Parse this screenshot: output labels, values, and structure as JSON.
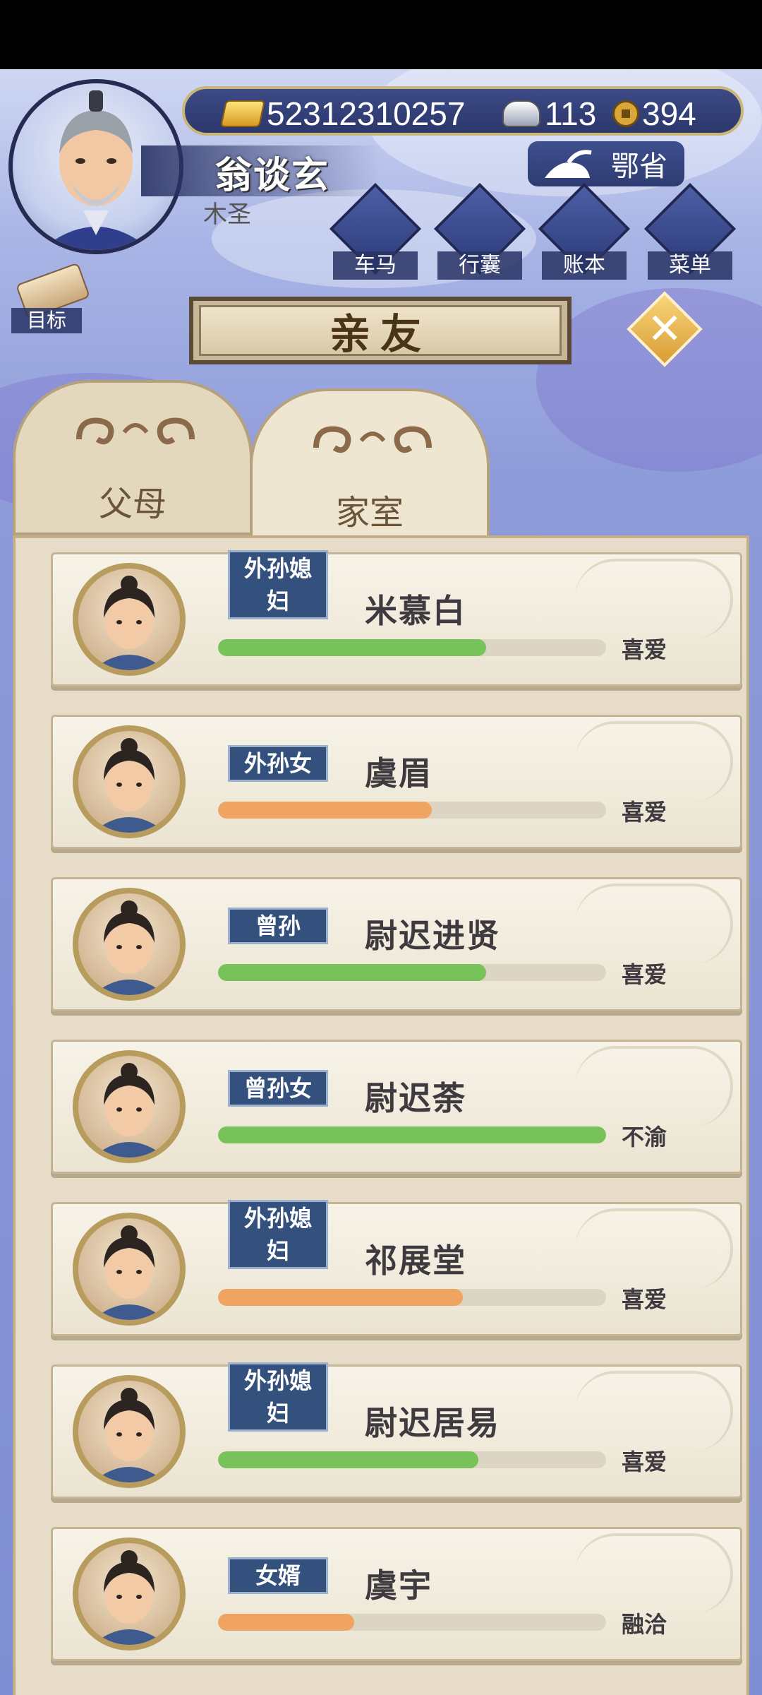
{
  "header": {
    "gold": "52312310257",
    "silver": "113",
    "coins": "394",
    "player_name": "翁谈玄",
    "player_title": "木圣",
    "location": "鄂省"
  },
  "menu": [
    {
      "label": "车马",
      "icon": "carriage-icon"
    },
    {
      "label": "行囊",
      "icon": "bag-icon"
    },
    {
      "label": "账本",
      "icon": "ledger-icon"
    },
    {
      "label": "菜单",
      "icon": "more-icon"
    }
  ],
  "goal_label": "目标",
  "page_title": "亲友",
  "tabs": [
    {
      "label": "父母",
      "active": false
    },
    {
      "label": "家室",
      "active": true
    }
  ],
  "colors": {
    "green": "#78c25a",
    "orange": "#f0a462",
    "relation_bg": "#33517c"
  },
  "relatives": [
    {
      "relation": "外孙媳妇",
      "relation_lines": [
        "外孙媳",
        "妇"
      ],
      "name": "米慕白",
      "affection": 0.69,
      "bar_color": "green",
      "status": "喜爱"
    },
    {
      "relation": "外孙女",
      "relation_lines": [
        "外孙女"
      ],
      "name": "虞眉",
      "affection": 0.55,
      "bar_color": "orange",
      "status": "喜爱"
    },
    {
      "relation": "曾孙",
      "relation_lines": [
        "曾孙"
      ],
      "name": "尉迟进贤",
      "affection": 0.69,
      "bar_color": "green",
      "status": "喜爱"
    },
    {
      "relation": "曾孙女",
      "relation_lines": [
        "曾孙女"
      ],
      "name": "尉迟荼",
      "affection": 1.0,
      "bar_color": "green",
      "status": "不渝"
    },
    {
      "relation": "外孙媳妇",
      "relation_lines": [
        "外孙媳",
        "妇"
      ],
      "name": "祁展堂",
      "affection": 0.63,
      "bar_color": "orange",
      "status": "喜爱"
    },
    {
      "relation": "外孙媳妇",
      "relation_lines": [
        "外孙媳",
        "妇"
      ],
      "name": "尉迟居易",
      "affection": 0.67,
      "bar_color": "green",
      "status": "喜爱"
    },
    {
      "relation": "女婿",
      "relation_lines": [
        "女婿"
      ],
      "name": "虞宇",
      "affection": 0.35,
      "bar_color": "orange",
      "status": "融洽"
    }
  ]
}
